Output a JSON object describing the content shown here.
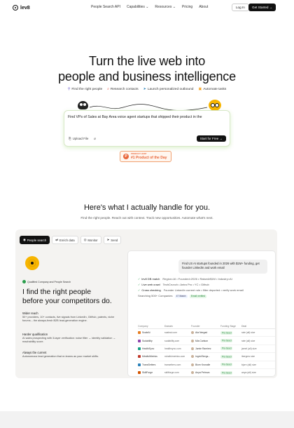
{
  "nav": {
    "brand": "lev8",
    "links": [
      "People Search API",
      "Capabilities ⌄",
      "Resources ⌄",
      "Pricing",
      "About"
    ],
    "login": "Log In",
    "get_started": "Get Started →"
  },
  "hero": {
    "title_line1": "Turn the live web into",
    "title_line2": "people and business intelligence",
    "tasks": [
      {
        "icon": "user-icon",
        "glyph": "⚲",
        "label": "Find the right people"
      },
      {
        "icon": "search-icon",
        "glyph": "⌕",
        "label": "Research contacts"
      },
      {
        "icon": "send-icon",
        "glyph": "➤",
        "label": "Launch personalized outbound"
      },
      {
        "icon": "task-icon",
        "glyph": "▣",
        "label": "Automate tasks"
      }
    ],
    "search_value": "Find VPs of Sales at Bay Area voice agent startups that shipped their product in the",
    "upload_label": "Upload File",
    "start_button": "Start for Free →",
    "ph_small": "PRODUCT HUNT",
    "ph_big": "#1 Product of the Day",
    "ph_letter": "P"
  },
  "section": {
    "title": "Here's what I actually handle for you.",
    "subtitle": "Find the right people. Reach out with context. Track new opportunities. Automate what's next."
  },
  "panel": {
    "tabs": [
      "People search",
      "Enrich data",
      "Monitor",
      "Send"
    ],
    "badge": "Qualified Company and People Search",
    "headline_1": "I find the right people",
    "headline_2": "before your competitors do.",
    "features": [
      {
        "title": "Wider reach",
        "text": "50+ providers, 10+ contacts, live signals from LinkedIn, GitHub, patents, niche forums – the always-fresh B2B lead-generation engine."
      },
      {
        "title": "Harder qualification",
        "text": "AI sales prospecting with 3-layer verification: noise filter → identity validation → reachability score."
      },
      {
        "title": "Always the current",
        "text": "Autonomous lead generation that re-learns as your market shifts."
      }
    ],
    "query": "Find US AI startups founded in 2026 with $1M+ funding, get founder LinkedIn and work email",
    "steps": [
      {
        "name": "lev8 DB match",
        "detail": "Region=AI • Founded=2026 • Raised≥$1M • Industry=AI"
      },
      {
        "name": "Live web crawl",
        "detail": "TechCrunch • Antra Pro • YC • Github"
      },
      {
        "name": "Cross checking",
        "detail": "Founder LinkedIn current role • filter deported • verify work email"
      }
    ],
    "searching_label": "Searching 500+ Companies",
    "match_count": "47 Match",
    "email_verified": "Email verified",
    "columns": [
      "Company",
      "Domain",
      "Founder",
      "Funding Stage",
      "Deal"
    ],
    "rows": [
      {
        "company": "ScaleAi",
        "domain": "scaleai.com",
        "founder": "Ata Nergad",
        "stage": "Pre-Seed",
        "deal": "rate (all) size",
        "color": "#e67e22"
      },
      {
        "company": "Sudability",
        "domain": "sudability.com",
        "founder": "Mia Carlson",
        "stage": "Pre-Seed",
        "deal": "rate (all) size",
        "color": "#8e44ad"
      },
      {
        "company": "HealthSync",
        "domain": "healthsync.com",
        "founder": "Jamie Ramirez",
        "stage": "Pre-Seed",
        "deal": "jamel (all) size",
        "color": "#16a085"
      },
      {
        "company": "MindfulMetrics",
        "domain": "mindfulmetrics.com",
        "founder": "Ingrid Bergs...",
        "stage": "Pre-Seed",
        "deal": "ibergms size",
        "color": "#c0392b"
      },
      {
        "company": "TransSetters",
        "domain": "transetters.com",
        "founder": "Biorn Kronalle",
        "stage": "Pre-Seed",
        "deal": "bjorn (all) size",
        "color": "#2980b9"
      },
      {
        "company": "SkillForge",
        "domain": "skillforge.com",
        "founder": "Anya Petrova",
        "stage": "Pre-Seed",
        "deal": "anya (all) size",
        "color": "#d35400"
      }
    ]
  }
}
